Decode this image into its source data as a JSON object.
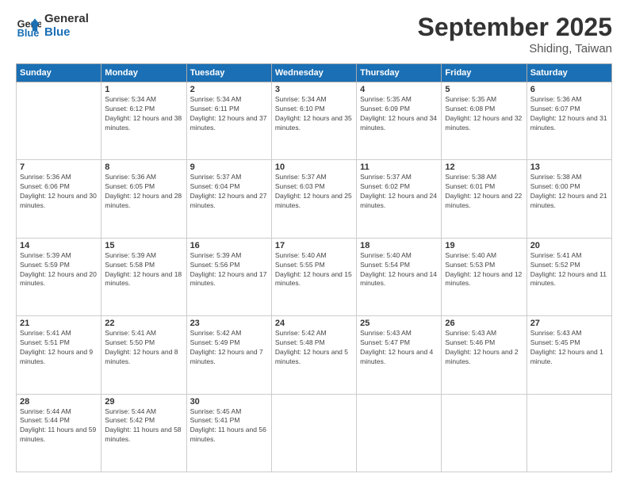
{
  "logo": {
    "line1": "General",
    "line2": "Blue"
  },
  "title": "September 2025",
  "location": "Shiding, Taiwan",
  "weekdays": [
    "Sunday",
    "Monday",
    "Tuesday",
    "Wednesday",
    "Thursday",
    "Friday",
    "Saturday"
  ],
  "weeks": [
    [
      null,
      {
        "day": 1,
        "sunrise": "5:34 AM",
        "sunset": "6:12 PM",
        "daylight": "12 hours and 38 minutes."
      },
      {
        "day": 2,
        "sunrise": "5:34 AM",
        "sunset": "6:11 PM",
        "daylight": "12 hours and 37 minutes."
      },
      {
        "day": 3,
        "sunrise": "5:34 AM",
        "sunset": "6:10 PM",
        "daylight": "12 hours and 35 minutes."
      },
      {
        "day": 4,
        "sunrise": "5:35 AM",
        "sunset": "6:09 PM",
        "daylight": "12 hours and 34 minutes."
      },
      {
        "day": 5,
        "sunrise": "5:35 AM",
        "sunset": "6:08 PM",
        "daylight": "12 hours and 32 minutes."
      },
      {
        "day": 6,
        "sunrise": "5:36 AM",
        "sunset": "6:07 PM",
        "daylight": "12 hours and 31 minutes."
      }
    ],
    [
      {
        "day": 7,
        "sunrise": "5:36 AM",
        "sunset": "6:06 PM",
        "daylight": "12 hours and 30 minutes."
      },
      {
        "day": 8,
        "sunrise": "5:36 AM",
        "sunset": "6:05 PM",
        "daylight": "12 hours and 28 minutes."
      },
      {
        "day": 9,
        "sunrise": "5:37 AM",
        "sunset": "6:04 PM",
        "daylight": "12 hours and 27 minutes."
      },
      {
        "day": 10,
        "sunrise": "5:37 AM",
        "sunset": "6:03 PM",
        "daylight": "12 hours and 25 minutes."
      },
      {
        "day": 11,
        "sunrise": "5:37 AM",
        "sunset": "6:02 PM",
        "daylight": "12 hours and 24 minutes."
      },
      {
        "day": 12,
        "sunrise": "5:38 AM",
        "sunset": "6:01 PM",
        "daylight": "12 hours and 22 minutes."
      },
      {
        "day": 13,
        "sunrise": "5:38 AM",
        "sunset": "6:00 PM",
        "daylight": "12 hours and 21 minutes."
      }
    ],
    [
      {
        "day": 14,
        "sunrise": "5:39 AM",
        "sunset": "5:59 PM",
        "daylight": "12 hours and 20 minutes."
      },
      {
        "day": 15,
        "sunrise": "5:39 AM",
        "sunset": "5:58 PM",
        "daylight": "12 hours and 18 minutes."
      },
      {
        "day": 16,
        "sunrise": "5:39 AM",
        "sunset": "5:56 PM",
        "daylight": "12 hours and 17 minutes."
      },
      {
        "day": 17,
        "sunrise": "5:40 AM",
        "sunset": "5:55 PM",
        "daylight": "12 hours and 15 minutes."
      },
      {
        "day": 18,
        "sunrise": "5:40 AM",
        "sunset": "5:54 PM",
        "daylight": "12 hours and 14 minutes."
      },
      {
        "day": 19,
        "sunrise": "5:40 AM",
        "sunset": "5:53 PM",
        "daylight": "12 hours and 12 minutes."
      },
      {
        "day": 20,
        "sunrise": "5:41 AM",
        "sunset": "5:52 PM",
        "daylight": "12 hours and 11 minutes."
      }
    ],
    [
      {
        "day": 21,
        "sunrise": "5:41 AM",
        "sunset": "5:51 PM",
        "daylight": "12 hours and 9 minutes."
      },
      {
        "day": 22,
        "sunrise": "5:41 AM",
        "sunset": "5:50 PM",
        "daylight": "12 hours and 8 minutes."
      },
      {
        "day": 23,
        "sunrise": "5:42 AM",
        "sunset": "5:49 PM",
        "daylight": "12 hours and 7 minutes."
      },
      {
        "day": 24,
        "sunrise": "5:42 AM",
        "sunset": "5:48 PM",
        "daylight": "12 hours and 5 minutes."
      },
      {
        "day": 25,
        "sunrise": "5:43 AM",
        "sunset": "5:47 PM",
        "daylight": "12 hours and 4 minutes."
      },
      {
        "day": 26,
        "sunrise": "5:43 AM",
        "sunset": "5:46 PM",
        "daylight": "12 hours and 2 minutes."
      },
      {
        "day": 27,
        "sunrise": "5:43 AM",
        "sunset": "5:45 PM",
        "daylight": "12 hours and 1 minute."
      }
    ],
    [
      {
        "day": 28,
        "sunrise": "5:44 AM",
        "sunset": "5:44 PM",
        "daylight": "11 hours and 59 minutes."
      },
      {
        "day": 29,
        "sunrise": "5:44 AM",
        "sunset": "5:42 PM",
        "daylight": "11 hours and 58 minutes."
      },
      {
        "day": 30,
        "sunrise": "5:45 AM",
        "sunset": "5:41 PM",
        "daylight": "11 hours and 56 minutes."
      },
      null,
      null,
      null,
      null
    ]
  ]
}
